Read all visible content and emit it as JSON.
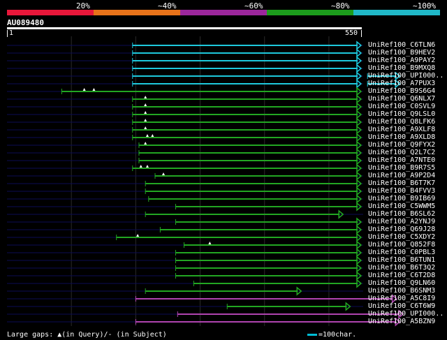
{
  "legend": [
    {
      "label": "20%",
      "color": "#e8173a"
    },
    {
      "label": "~40%",
      "color": "#e8731a"
    },
    {
      "label": "~60%",
      "color": "#9c279c"
    },
    {
      "label": "~80%",
      "color": "#1c9c1c"
    },
    {
      "label": "~100%",
      "color": "#20b8c8"
    }
  ],
  "query": {
    "id": "AU089480",
    "start": "1",
    "end": "550",
    "length": 550
  },
  "colors": {
    "cyan": "#1ec8dc",
    "green": "#22a622",
    "purple": "#b044b0",
    "gap_marker": "#ffffff",
    "row_track": "#0c0c55",
    "grid": "#2a2a2a"
  },
  "hits": [
    {
      "label": "UniRef100_C6TLN6",
      "color": "cyan",
      "segments": [
        [
          195,
          550
        ]
      ],
      "markers": []
    },
    {
      "label": "UniRef100_B9HEV2",
      "color": "cyan",
      "segments": [
        [
          195,
          550
        ]
      ],
      "markers": []
    },
    {
      "label": "UniRef100_A9PAY2",
      "color": "cyan",
      "segments": [
        [
          195,
          550
        ]
      ],
      "markers": []
    },
    {
      "label": "UniRef100_B9MXQ8",
      "color": "cyan",
      "segments": [
        [
          195,
          550
        ]
      ],
      "markers": []
    },
    {
      "label": "UniRef100_UPI000..",
      "color": "cyan",
      "segments": [
        [
          195,
          550
        ]
      ],
      "extra": [
        [
          560,
          610
        ]
      ],
      "markers": []
    },
    {
      "label": "UniRef100_A7PUX3",
      "color": "cyan",
      "segments": [
        [
          195,
          550
        ]
      ],
      "extra": [
        [
          560,
          610
        ]
      ],
      "markers": []
    },
    {
      "label": "UniRef100_B9S6G4",
      "color": "green",
      "segments": [
        [
          85,
          550
        ]
      ],
      "markers": [
        120,
        135
      ]
    },
    {
      "label": "UniRef100_Q6NLX7",
      "color": "green",
      "segments": [
        [
          195,
          550
        ]
      ],
      "markers": [
        215
      ]
    },
    {
      "label": "UniRef100_C0SVL9",
      "color": "green",
      "segments": [
        [
          195,
          550
        ]
      ],
      "markers": [
        215
      ]
    },
    {
      "label": "UniRef100_Q9LSL0",
      "color": "green",
      "segments": [
        [
          195,
          550
        ]
      ],
      "markers": [
        215
      ]
    },
    {
      "label": "UniRef100_Q8LFK6",
      "color": "green",
      "segments": [
        [
          195,
          550
        ]
      ],
      "markers": [
        215
      ]
    },
    {
      "label": "UniRef100_A9XLF8",
      "color": "green",
      "segments": [
        [
          195,
          550
        ]
      ],
      "markers": [
        215
      ]
    },
    {
      "label": "UniRef100_A9XLD8",
      "color": "green",
      "segments": [
        [
          195,
          550
        ]
      ],
      "markers": [
        218,
        226
      ]
    },
    {
      "label": "UniRef100_Q9FYX2",
      "color": "green",
      "segments": [
        [
          205,
          550
        ]
      ],
      "markers": [
        215
      ]
    },
    {
      "label": "UniRef100_Q2L7C2",
      "color": "green",
      "segments": [
        [
          205,
          550
        ]
      ],
      "markers": []
    },
    {
      "label": "UniRef100_A7NTE0",
      "color": "green",
      "segments": [
        [
          205,
          550
        ]
      ],
      "markers": []
    },
    {
      "label": "UniRef100_B9R7S5",
      "color": "green",
      "segments": [
        [
          195,
          550
        ]
      ],
      "markers": [
        208,
        218
      ]
    },
    {
      "label": "UniRef100_A9P2D4",
      "color": "green",
      "segments": [
        [
          230,
          550
        ]
      ],
      "markers": [
        243
      ]
    },
    {
      "label": "UniRef100_B6T7K7",
      "color": "green",
      "segments": [
        [
          215,
          550
        ]
      ],
      "markers": []
    },
    {
      "label": "UniRef100_B4FVV3",
      "color": "green",
      "segments": [
        [
          215,
          550
        ]
      ],
      "markers": []
    },
    {
      "label": "UniRef100_B9IB69",
      "color": "green",
      "segments": [
        [
          220,
          550
        ]
      ],
      "markers": []
    },
    {
      "label": "UniRef100_C5WWM5",
      "color": "green",
      "segments": [
        [
          262,
          550
        ]
      ],
      "markers": []
    },
    {
      "label": "UniRef100_B6SL62",
      "color": "green",
      "segments": [
        [
          215,
          522
        ]
      ],
      "markers": []
    },
    {
      "label": "UniRef100_A2YNJ9",
      "color": "green",
      "segments": [
        [
          262,
          550
        ]
      ],
      "markers": []
    },
    {
      "label": "UniRef100_Q69J28",
      "color": "green",
      "segments": [
        [
          238,
          550
        ]
      ],
      "markers": []
    },
    {
      "label": "UniRef100_C5XDY2",
      "color": "green",
      "segments": [
        [
          170,
          550
        ]
      ],
      "markers": [
        203
      ]
    },
    {
      "label": "UniRef100_Q852F8",
      "color": "green",
      "segments": [
        [
          275,
          550
        ]
      ],
      "markers": [
        315
      ]
    },
    {
      "label": "UniRef100_C0PBL3",
      "color": "green",
      "segments": [
        [
          262,
          550
        ]
      ],
      "markers": []
    },
    {
      "label": "UniRef100_B6TUN1",
      "color": "green",
      "segments": [
        [
          262,
          550
        ]
      ],
      "markers": []
    },
    {
      "label": "UniRef100_B6T3Q2",
      "color": "green",
      "segments": [
        [
          262,
          550
        ]
      ],
      "markers": []
    },
    {
      "label": "UniRef100_C6T2D8",
      "color": "green",
      "segments": [
        [
          262,
          550
        ]
      ],
      "markers": []
    },
    {
      "label": "UniRef100_Q9LN60",
      "color": "green",
      "segments": [
        [
          290,
          550
        ]
      ],
      "markers": []
    },
    {
      "label": "UniRef100_B6SNM3",
      "color": "green",
      "segments": [
        [
          215,
          457
        ]
      ],
      "markers": []
    },
    {
      "label": "UniRef100_A5C8I9",
      "color": "purple",
      "segments": [
        [
          200,
          605
        ]
      ],
      "markers": []
    },
    {
      "label": "UniRef100_C6T6W9",
      "color": "green",
      "segments": [
        [
          342,
          533
        ]
      ],
      "markers": []
    },
    {
      "label": "UniRef100_UPI000..",
      "color": "purple",
      "segments": [
        [
          265,
          615
        ]
      ],
      "markers": []
    },
    {
      "label": "UniRef100_A5BZN9",
      "color": "purple",
      "segments": [
        [
          200,
          610
        ]
      ],
      "markers": []
    }
  ],
  "footer": {
    "text": "Large gaps: ▲(in Query)/- (in Subject)",
    "scale": "=100char."
  }
}
